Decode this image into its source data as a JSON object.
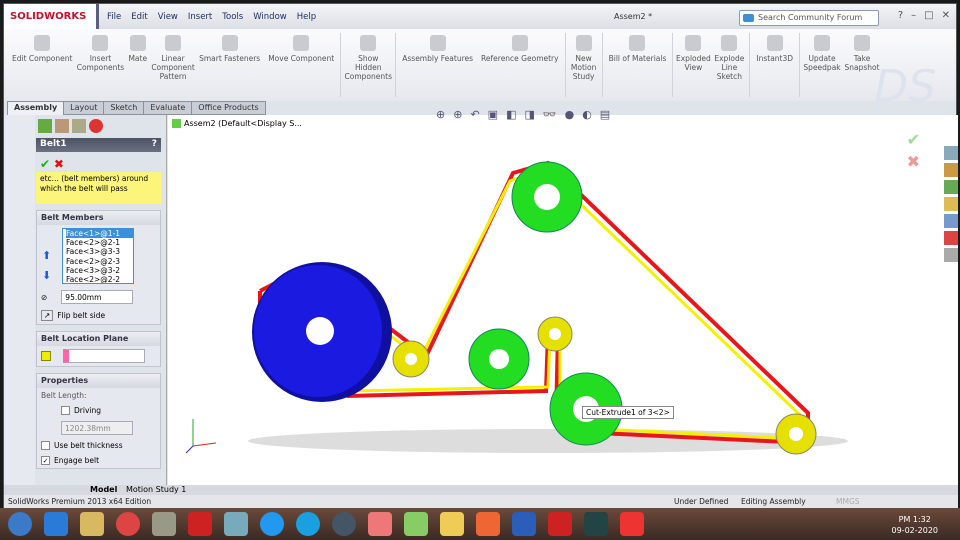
{
  "app": {
    "brand": "SOLIDWORKS",
    "title": "Assem2 *",
    "search_placeholder": "Search Community Forum"
  },
  "menu": [
    "File",
    "Edit",
    "View",
    "Insert",
    "Tools",
    "Window",
    "Help"
  ],
  "ribbon": [
    "Edit Component",
    "Insert Components",
    "Mate",
    "Linear Component Pattern",
    "Smart Fasteners",
    "Move Component",
    "Show Hidden Components",
    "Assembly Features",
    "Reference Geometry",
    "New Motion Study",
    "Bill of Materials",
    "Exploded View",
    "Explode Line Sketch",
    "Instant3D",
    "Update Speedpak",
    "Take Snapshot"
  ],
  "tabs": [
    "Assembly",
    "Layout",
    "Sketch",
    "Evaluate",
    "Office Products"
  ],
  "tree": {
    "root": "Assem2  (Default<Display S..."
  },
  "pm": {
    "title": "Belt1",
    "help": "?",
    "note": "etc... (belt members) around which the belt will pass",
    "belt_members": {
      "header": "Belt Members",
      "items": [
        "Face<1>@1-1",
        "Face<2>@2-1",
        "Face<3>@3-3",
        "Face<2>@2-3",
        "Face<3>@3-2",
        "Face<2>@2-2"
      ],
      "diameter": "95.00mm",
      "flip": "Flip belt side"
    },
    "plane": {
      "header": "Belt Location Plane"
    },
    "props": {
      "header": "Properties",
      "belt_length_label": "Belt Length:",
      "driving": "Driving",
      "length": "1202.38mm",
      "use_thickness": "Use belt thickness",
      "engage": "Engage belt"
    }
  },
  "tooltip": "Cut-Extrude1 of 3<2>",
  "bottom_tabs": [
    "Model",
    "Motion Study 1"
  ],
  "status": {
    "edition": "SolidWorks Premium 2013 x64 Edition",
    "state": "Under Defined",
    "mode": "Editing Assembly",
    "units": "MMGS"
  },
  "clock": {
    "time": "PM 1:32",
    "date": "09-02-2020"
  },
  "colors": {
    "belt_red": "#e8161a",
    "belt_yellow": "#f4f000",
    "pulley_blue": "#1a1ae0",
    "pulley_green": "#22dd22"
  }
}
